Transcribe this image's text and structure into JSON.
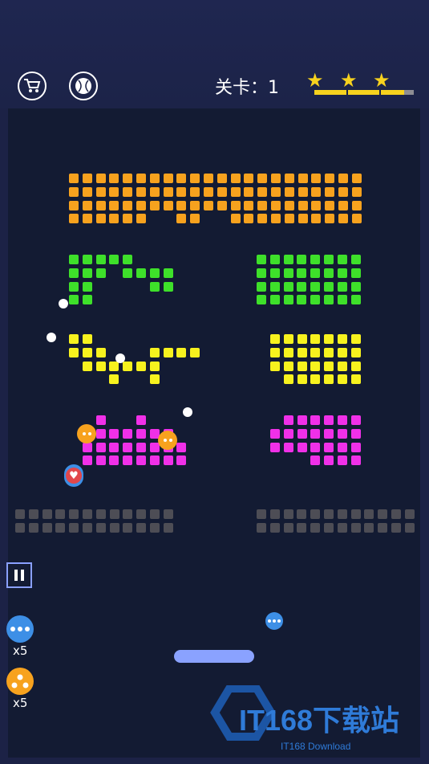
{
  "header": {
    "shop_icon": "cart-icon",
    "ball_icon": "ball-icon",
    "level_text": "关卡：1",
    "stars": 3,
    "star_progress": 0.9
  },
  "powerups": [
    {
      "icon": "multi-ball-icon",
      "color": "#3d8fe6",
      "count": "x5"
    },
    {
      "icon": "split-ball-icon",
      "color": "#f7a21e",
      "count": "x5"
    }
  ],
  "colors": {
    "orange": "#f7a21e",
    "green": "#3ee02a",
    "yellow": "#f7f21e",
    "magenta": "#f030e8",
    "gray": "#4d4d55",
    "paddle": "#8aa2ff"
  },
  "watermark": {
    "brand": "IT168下载站",
    "sub": "IT168 Download"
  }
}
